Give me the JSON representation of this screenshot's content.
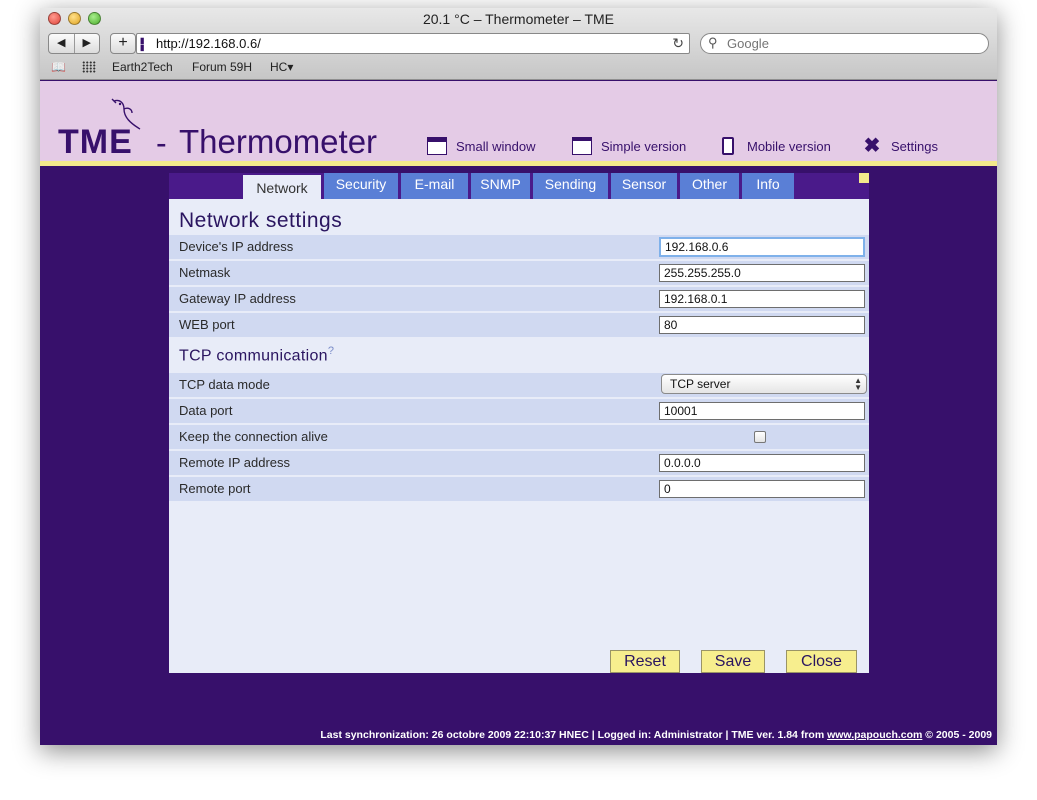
{
  "browser": {
    "window_title": "20.1 °C – Thermometer – TME",
    "back_icon": "◀",
    "forward_icon": "▶",
    "new_tab_icon": "+",
    "url": "http://192.168.0.6/",
    "search_placeholder": "Google",
    "bookmarks": [
      "Earth2Tech",
      "Forum 59H",
      "HC▾"
    ]
  },
  "header": {
    "logo": "TME",
    "dash": "-",
    "app_title": "Thermometer",
    "links": {
      "small_window": "Small window",
      "simple_version": "Simple version",
      "mobile_version": "Mobile version",
      "settings": "Settings"
    }
  },
  "tabs": [
    "Network",
    "Security",
    "E-mail",
    "SNMP",
    "Sending",
    "Sensor",
    "Other",
    "Info"
  ],
  "network": {
    "heading": "Network settings",
    "ip_label": "Device's IP address",
    "ip_value": "192.168.0.6",
    "netmask_label": "Netmask",
    "netmask_value": "255.255.255.0",
    "gateway_label": "Gateway IP address",
    "gateway_value": "192.168.0.1",
    "webport_label": "WEB port",
    "webport_value": "80"
  },
  "tcp": {
    "heading": "TCP communication",
    "help": "?",
    "mode_label": "TCP data mode",
    "mode_value": "TCP server",
    "dataport_label": "Data port",
    "dataport_value": "10001",
    "keepalive_label": "Keep the connection alive",
    "keepalive_checked": false,
    "remote_ip_label": "Remote IP address",
    "remote_ip_value": "0.0.0.0",
    "remote_port_label": "Remote port",
    "remote_port_value": "0"
  },
  "buttons": {
    "reset": "Reset",
    "save": "Save",
    "close": "Close"
  },
  "footer": {
    "text": "Last synchronization: 26 octobre 2009 22:10:37 HNEC | Logged in: Administrator | TME ver. 1.84 from ",
    "link": "www.papouch.com",
    "copyright": " © 2005 - 2009"
  },
  "colors": {
    "accent": "#37106b",
    "header_bg": "#e4cbe6",
    "tab": "#5a7fd6",
    "button": "#f7ee8e"
  }
}
